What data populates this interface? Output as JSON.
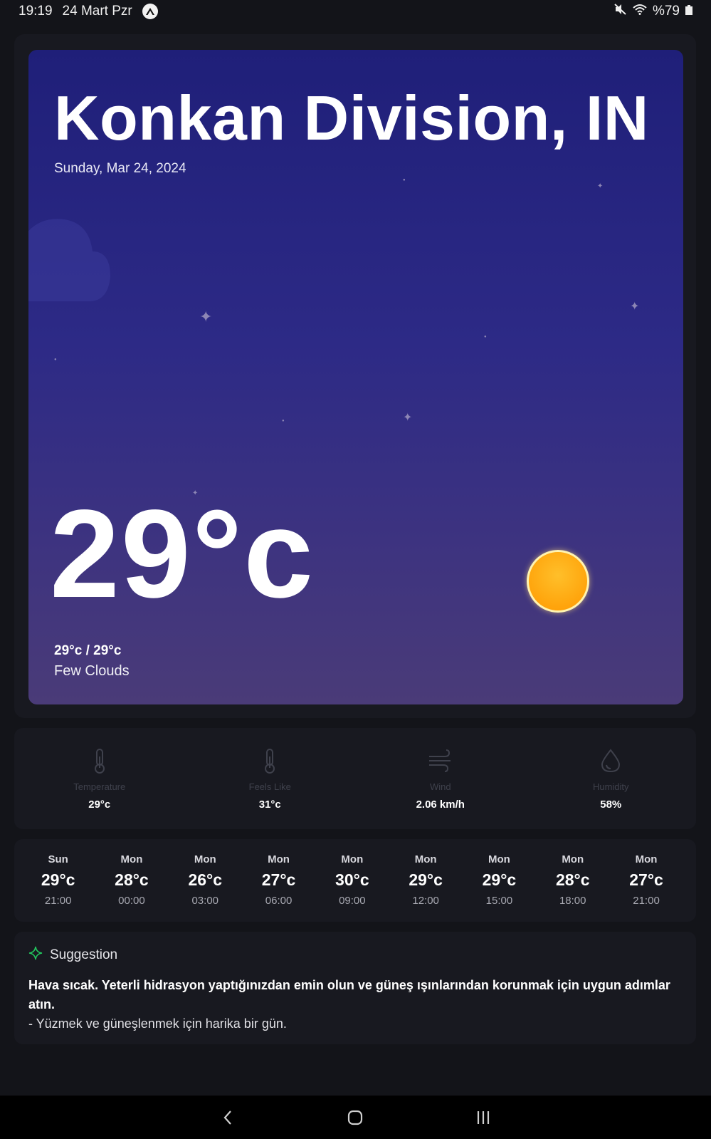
{
  "status_bar": {
    "time": "19:19",
    "date": "24 Mart Pzr",
    "battery": "%79"
  },
  "hero": {
    "city": "Konkan Division, IN",
    "date": "Sunday, Mar 24, 2024",
    "temperature": "29°c",
    "min_max": "29°c / 29°c",
    "condition": "Few Clouds",
    "weather_icon": "sun-icon"
  },
  "stats": [
    {
      "label": "Temperature",
      "value": "29°c",
      "icon": "thermometer-icon"
    },
    {
      "label": "Feels Like",
      "value": "31°c",
      "icon": "thermometer-icon"
    },
    {
      "label": "Wind",
      "value": "2.06 km/h",
      "icon": "wind-icon"
    },
    {
      "label": "Humidity",
      "value": "58%",
      "icon": "droplet-icon"
    }
  ],
  "forecast": [
    {
      "day": "Sun",
      "temp": "29°c",
      "time": "21:00"
    },
    {
      "day": "Mon",
      "temp": "28°c",
      "time": "00:00"
    },
    {
      "day": "Mon",
      "temp": "26°c",
      "time": "03:00"
    },
    {
      "day": "Mon",
      "temp": "27°c",
      "time": "06:00"
    },
    {
      "day": "Mon",
      "temp": "30°c",
      "time": "09:00"
    },
    {
      "day": "Mon",
      "temp": "29°c",
      "time": "12:00"
    },
    {
      "day": "Mon",
      "temp": "29°c",
      "time": "15:00"
    },
    {
      "day": "Mon",
      "temp": "28°c",
      "time": "18:00"
    },
    {
      "day": "Mon",
      "temp": "27°c",
      "time": "21:00"
    }
  ],
  "suggestion": {
    "title": "Suggestion",
    "main": "Hava sıcak. Yeterli hidrasyon yaptığınızdan emin olun ve güneş ışınlarından korunmak için uygun adımlar atın.",
    "sub": "- Yüzmek ve güneşlenmek için harika bir gün.",
    "accent_color": "#22c55e"
  },
  "colors": {
    "background": "#131419",
    "panel": "#181920",
    "hero_top": "#1f1f79",
    "hero_bottom": "#4a3b78",
    "sun": "#ffaa12"
  }
}
